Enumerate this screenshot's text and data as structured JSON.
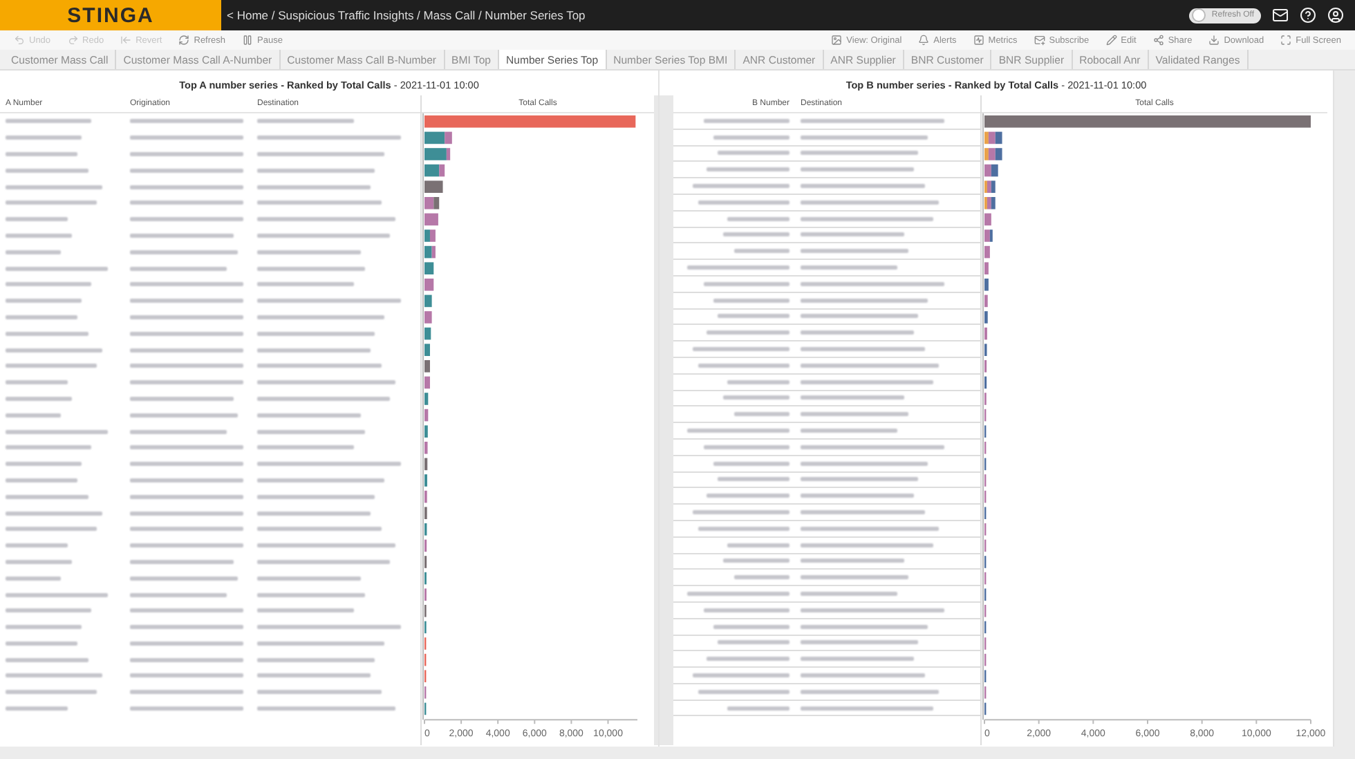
{
  "header": {
    "logo": "STINGA",
    "breadcrumb": "< Home / Suspicious Traffic Insights / Mass Call / Number Series Top",
    "refresh_toggle": {
      "label": "Refresh Off",
      "on": false
    }
  },
  "toolbar": {
    "left": [
      {
        "label": "Undo",
        "disabled": true
      },
      {
        "label": "Redo",
        "disabled": true
      },
      {
        "label": "Revert",
        "disabled": true
      },
      {
        "label": "Refresh",
        "disabled": false
      },
      {
        "label": "Pause",
        "disabled": false
      }
    ],
    "right": [
      {
        "label": "View: Original"
      },
      {
        "label": "Alerts"
      },
      {
        "label": "Metrics"
      },
      {
        "label": "Subscribe"
      },
      {
        "label": "Edit"
      },
      {
        "label": "Share"
      },
      {
        "label": "Download"
      },
      {
        "label": "Full Screen"
      }
    ]
  },
  "tabs": [
    {
      "label": "Customer Mass Call",
      "selected": false
    },
    {
      "label": "Customer Mass Call A-Number",
      "selected": false
    },
    {
      "label": "Customer Mass Call B-Number",
      "selected": false
    },
    {
      "label": "BMI Top",
      "selected": false
    },
    {
      "label": "Number Series Top",
      "selected": true
    },
    {
      "label": "Number Series Top BMI",
      "selected": false
    },
    {
      "label": "ANR Customer",
      "selected": false
    },
    {
      "label": "ANR Supplier",
      "selected": false
    },
    {
      "label": "BNR Customer",
      "selected": false
    },
    {
      "label": "BNR Supplier",
      "selected": false
    },
    {
      "label": "Robocall Anr",
      "selected": false
    },
    {
      "label": "Validated Ranges",
      "selected": false
    }
  ],
  "panels": [
    {
      "title": "**Top A number series  - Ranked by Total Calls** - 2021-11-01 10:00",
      "columns": [
        "A Number",
        "Origination",
        "Destination",
        "Total Calls"
      ],
      "chart_data": {
        "type": "bar",
        "orientation": "horizontal",
        "stacked": true,
        "categories": [
          null,
          null,
          null,
          null,
          null,
          null,
          null,
          null,
          null,
          null,
          null,
          null,
          null,
          null,
          null,
          null,
          null,
          null,
          null,
          null,
          null,
          null,
          null,
          null,
          null,
          null,
          null,
          null,
          null,
          null,
          null,
          null,
          null,
          null,
          null,
          null,
          null
        ],
        "xlim": [
          0,
          11600
        ],
        "xticks": [
          {
            "value": 0,
            "label": "0"
          },
          {
            "value": 2000,
            "label": "2,000"
          },
          {
            "value": 4000,
            "label": "4,000"
          },
          {
            "value": 6000,
            "label": "6,000"
          },
          {
            "value": 8000,
            "label": "8,000"
          },
          {
            "value": 10000,
            "label": "10,000"
          }
        ],
        "series": [
          {
            "color": "#e8675a",
            "values": [
              11500,
              0,
              0,
              0,
              0,
              0,
              0,
              0,
              0,
              0,
              0,
              0,
              0,
              0,
              0,
              0,
              0,
              0,
              0,
              0,
              0,
              0,
              0,
              0,
              0,
              0,
              0,
              0,
              0,
              0,
              0,
              0,
              60,
              70,
              70,
              0,
              0
            ]
          },
          {
            "color": "#3e8e96",
            "values": [
              0,
              1100,
              1200,
              800,
              0,
              0,
              0,
              300,
              400,
              500,
              0,
              400,
              0,
              350,
              300,
              0,
              0,
              200,
              0,
              180,
              0,
              0,
              150,
              0,
              0,
              130,
              0,
              0,
              110,
              0,
              0,
              100,
              0,
              0,
              0,
              0,
              80
            ]
          },
          {
            "color": "#b678a8",
            "values": [
              0,
              400,
              200,
              300,
              0,
              500,
              750,
              300,
              200,
              0,
              500,
              0,
              400,
              0,
              0,
              0,
              300,
              0,
              200,
              0,
              170,
              0,
              0,
              140,
              0,
              0,
              120,
              0,
              0,
              110,
              0,
              0,
              0,
              0,
              0,
              90,
              0
            ]
          },
          {
            "color": "#7a7174",
            "values": [
              0,
              0,
              0,
              0,
              1000,
              300,
              0,
              0,
              0,
              0,
              0,
              0,
              0,
              0,
              0,
              300,
              0,
              0,
              0,
              0,
              0,
              160,
              0,
              0,
              140,
              0,
              0,
              120,
              0,
              0,
              100,
              0,
              0,
              0,
              0,
              0,
              0
            ]
          }
        ]
      }
    },
    {
      "title": "**Top B number series - Ranked by Total Calls** - 2021-11-01 10:00",
      "columns": [
        "B Number",
        "Destination",
        "Total Calls"
      ],
      "chart_data": {
        "type": "bar",
        "orientation": "horizontal",
        "stacked": true,
        "categories": [
          null,
          null,
          null,
          null,
          null,
          null,
          null,
          null,
          null,
          null,
          null,
          null,
          null,
          null,
          null,
          null,
          null,
          null,
          null,
          null,
          null,
          null,
          null,
          null,
          null,
          null,
          null,
          null,
          null,
          null,
          null,
          null,
          null,
          null,
          null,
          null,
          null
        ],
        "xlim": [
          0,
          12000
        ],
        "xticks": [
          {
            "value": 0,
            "label": "0"
          },
          {
            "value": 2000,
            "label": "2,000"
          },
          {
            "value": 4000,
            "label": "4,000"
          },
          {
            "value": 6000,
            "label": "6,000"
          },
          {
            "value": 8000,
            "label": "8,000"
          },
          {
            "value": 10000,
            "label": "10,000"
          },
          {
            "value": 12000,
            "label": "12,000"
          }
        ],
        "series": [
          {
            "color": "#7a7174",
            "values": [
              12000,
              0,
              0,
              0,
              0,
              0,
              0,
              0,
              0,
              0,
              0,
              0,
              0,
              0,
              0,
              0,
              0,
              0,
              0,
              0,
              0,
              0,
              0,
              0,
              0,
              0,
              0,
              0,
              0,
              0,
              0,
              0,
              0,
              0,
              0,
              0,
              0
            ]
          },
          {
            "color": "#e9a24a",
            "values": [
              0,
              150,
              150,
              0,
              100,
              100,
              0,
              0,
              0,
              0,
              0,
              0,
              0,
              0,
              0,
              0,
              0,
              0,
              0,
              0,
              0,
              0,
              0,
              0,
              0,
              0,
              0,
              0,
              0,
              0,
              0,
              0,
              0,
              0,
              0,
              0,
              0
            ]
          },
          {
            "color": "#b678a8",
            "values": [
              0,
              250,
              250,
              250,
              150,
              150,
              250,
              200,
              200,
              150,
              0,
              120,
              0,
              100,
              0,
              80,
              0,
              70,
              60,
              0,
              50,
              0,
              40,
              40,
              0,
              30,
              30,
              0,
              30,
              0,
              30,
              0,
              30,
              30,
              0,
              30,
              0
            ]
          },
          {
            "color": "#4e6fa0",
            "values": [
              0,
              250,
              250,
              250,
              150,
              150,
              0,
              100,
              0,
              0,
              150,
              0,
              120,
              0,
              90,
              0,
              80,
              0,
              0,
              60,
              0,
              50,
              0,
              0,
              40,
              0,
              0,
              30,
              0,
              30,
              0,
              30,
              0,
              0,
              30,
              0,
              30
            ]
          }
        ]
      }
    }
  ]
}
